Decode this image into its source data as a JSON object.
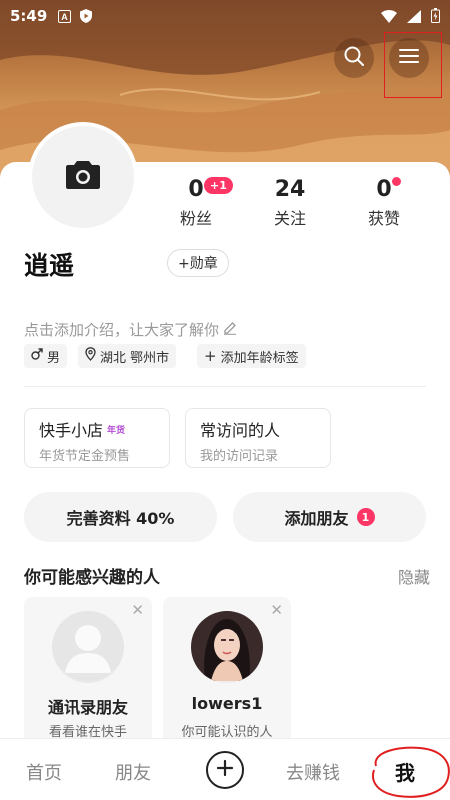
{
  "status_bar": {
    "time": "5:49"
  },
  "profile": {
    "username": "逍遥",
    "medal_label": "+勋章",
    "intro_placeholder": "点击添加介绍，让大家了解你",
    "tags": {
      "gender": "男",
      "location": "湖北 鄂州市",
      "age": "添加年龄标签"
    }
  },
  "stats": {
    "fans": {
      "value": "0",
      "label": "粉丝",
      "badge": "+1"
    },
    "following": {
      "value": "24",
      "label": "关注"
    },
    "likes": {
      "value": "0",
      "label": "获赞"
    }
  },
  "cards": {
    "shop": {
      "title": "快手小店",
      "badge": "年货",
      "subtitle": "年货节定金预售"
    },
    "visitors": {
      "title": "常访问的人",
      "subtitle": "我的访问记录"
    }
  },
  "actions": {
    "complete_profile": "完善资料 40%",
    "add_friend": "添加朋友",
    "add_friend_count": "1"
  },
  "suggestions": {
    "title": "你可能感兴趣的人",
    "hide_label": "隐藏",
    "items": [
      {
        "name": "通讯录朋友",
        "subtitle": "看看谁在快手"
      },
      {
        "name": "lowers1",
        "subtitle": "你可能认识的人"
      }
    ]
  },
  "bottom_nav": {
    "home": "首页",
    "friends": "朋友",
    "earn": "去赚钱",
    "me": "我"
  },
  "colors": {
    "accent": "#fe3666",
    "highlight": "#e02020"
  }
}
